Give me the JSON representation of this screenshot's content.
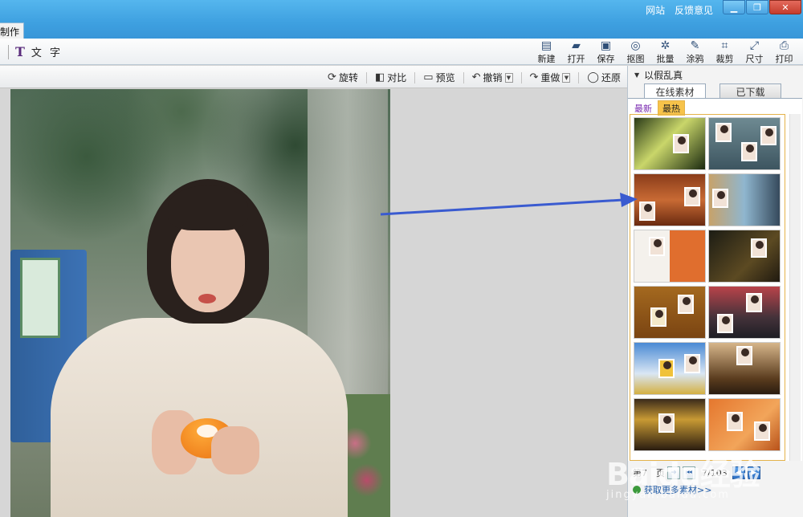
{
  "titlebar": {
    "links": [
      "网站",
      "反馈意见"
    ],
    "window_buttons": [
      "minimize",
      "restore",
      "close"
    ],
    "mode_tab": "制作"
  },
  "toolbar": {
    "text_tool": "文 字",
    "tools": [
      {
        "label": "新建",
        "icon": "new-file-icon"
      },
      {
        "label": "打开",
        "icon": "folder-open-icon"
      },
      {
        "label": "保存",
        "icon": "save-disk-icon"
      },
      {
        "label": "抠图",
        "icon": "cutout-icon"
      },
      {
        "label": "批量",
        "icon": "batch-gear-icon"
      },
      {
        "label": "涂鸦",
        "icon": "doodle-icon"
      },
      {
        "label": "裁剪",
        "icon": "crop-icon"
      },
      {
        "label": "尺寸",
        "icon": "resize-icon"
      },
      {
        "label": "打印",
        "icon": "printer-icon"
      }
    ]
  },
  "editbar": {
    "rotate": "旋转",
    "compare": "对比",
    "preview": "预览",
    "undo": "撤销",
    "redo": "重做",
    "restore": "还原"
  },
  "right_panel": {
    "section_title": "以假乱真",
    "tabs": {
      "online": "在线素材",
      "downloaded": "已下载"
    },
    "subtabs": {
      "newest": "最新",
      "hottest": "最热"
    },
    "thumbnails_count": 12,
    "pager": {
      "prefix": "第",
      "page_label": "页",
      "current": "7",
      "total_label": "7/103"
    },
    "more_link": "获取更多素材>>"
  },
  "watermark": {
    "brand": "Baidu经验",
    "sub": "jingyan.baidu.com"
  },
  "colors": {
    "titlebar": "#3ea0e0",
    "accent_orange": "#e4b24a",
    "arrow": "#3a5bd0"
  }
}
